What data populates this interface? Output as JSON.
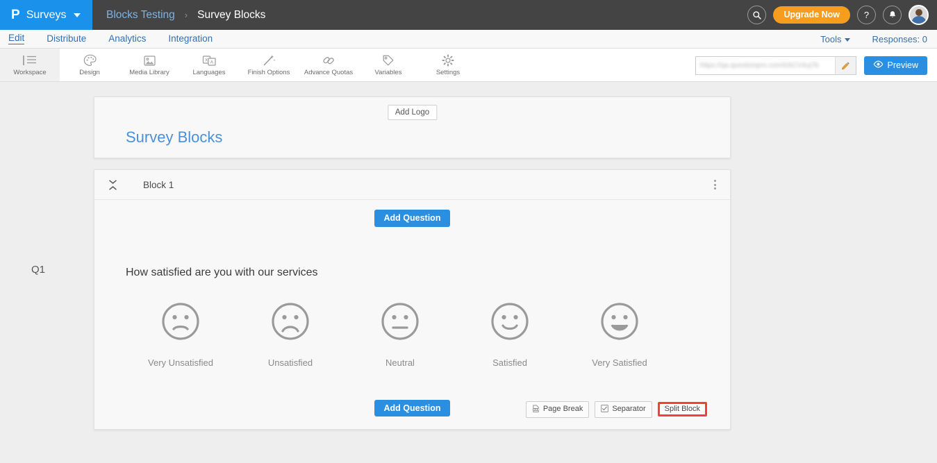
{
  "topbar": {
    "brand_logo": "P",
    "brand_text": "Surveys",
    "breadcrumb_parent": "Blocks Testing",
    "breadcrumb_sep": "›",
    "breadcrumb_current": "Survey Blocks",
    "search_icon": "search-icon",
    "upgrade_label": "Upgrade Now",
    "help_icon": "?",
    "bell_icon": "🔔",
    "avatar": "user-avatar"
  },
  "navtabs": {
    "items": [
      {
        "label": "Edit",
        "active": true
      },
      {
        "label": "Distribute",
        "active": false
      },
      {
        "label": "Analytics",
        "active": false
      },
      {
        "label": "Integration",
        "active": false
      }
    ],
    "tools_label": "Tools",
    "responses_label": "Responses: 0"
  },
  "ribbon": {
    "items": [
      {
        "label": "Workspace",
        "icon": "workspace-icon",
        "active": true
      },
      {
        "label": "Design",
        "icon": "palette-icon",
        "active": false
      },
      {
        "label": "Media Library",
        "icon": "image-icon",
        "active": false
      },
      {
        "label": "Languages",
        "icon": "translate-icon",
        "active": false
      },
      {
        "label": "Finish Options",
        "icon": "wand-icon",
        "active": false
      },
      {
        "label": "Advance Quotas",
        "icon": "link-icon",
        "active": false
      },
      {
        "label": "Variables",
        "icon": "tag-icon",
        "active": false
      },
      {
        "label": "Settings",
        "icon": "gear-icon",
        "active": false
      }
    ],
    "survey_url": "https://qa.questionpro.com/t/ACV4uj7b",
    "edit_icon": "pencil-icon",
    "preview_label": "Preview",
    "preview_icon": "eye-icon"
  },
  "canvas": {
    "question_number": "Q1",
    "header_card": {
      "add_logo_label": "Add Logo",
      "survey_title": "Survey Blocks"
    },
    "block": {
      "collapse_icon": "collapse-icon",
      "title": "Block 1",
      "kebab_icon": "more-vertical-icon",
      "add_question_top": "Add Question",
      "add_question_bottom": "Add Question",
      "question_text": "How satisfied are you with our services",
      "scale": [
        {
          "label": "Very Unsatisfied",
          "face": "very-unsatisfied"
        },
        {
          "label": "Unsatisfied",
          "face": "unsatisfied"
        },
        {
          "label": "Neutral",
          "face": "neutral"
        },
        {
          "label": "Satisfied",
          "face": "satisfied"
        },
        {
          "label": "Very Satisfied",
          "face": "very-satisfied"
        }
      ],
      "page_break_label": "Page Break",
      "separator_label": "Separator",
      "split_block_label": "Split Block"
    }
  },
  "colors": {
    "brand_blue": "#1a91eb",
    "topbar_dark": "#444444",
    "accent_orange": "#f79d1e",
    "button_blue": "#2a8fe0",
    "highlight_red": "#f4422e",
    "page_bg": "#eeeeee",
    "card_bg": "#f8f8f8"
  }
}
